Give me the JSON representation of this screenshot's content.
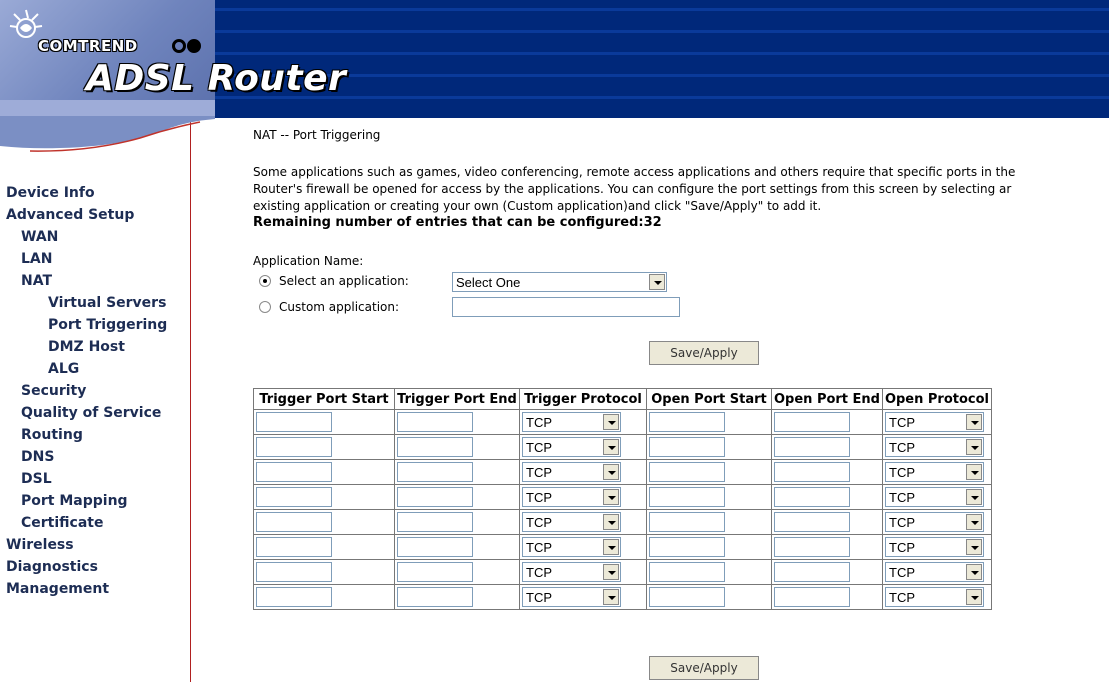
{
  "header": {
    "brand": "COMTREND",
    "product": "ADSL Router"
  },
  "sidebar": {
    "items": [
      {
        "label": "Device Info"
      },
      {
        "label": "Advanced Setup"
      },
      {
        "label": "WAN"
      },
      {
        "label": "LAN"
      },
      {
        "label": "NAT"
      },
      {
        "label": "Virtual Servers"
      },
      {
        "label": "Port Triggering"
      },
      {
        "label": "DMZ Host"
      },
      {
        "label": "ALG"
      },
      {
        "label": "Security"
      },
      {
        "label": "Quality of Service"
      },
      {
        "label": "Routing"
      },
      {
        "label": "DNS"
      },
      {
        "label": "DSL"
      },
      {
        "label": "Port Mapping"
      },
      {
        "label": "Certificate"
      },
      {
        "label": "Wireless"
      },
      {
        "label": "Diagnostics"
      },
      {
        "label": "Management"
      }
    ]
  },
  "main": {
    "title": "NAT -- Port Triggering",
    "description_lines": [
      "Some applications such as games, video conferencing, remote access applications and others require that specific ports in the",
      "Router's firewall be opened for access by the applications. You can configure the port settings from this screen by selecting ar",
      "existing application or creating your own (Custom application)and click \"Save/Apply\" to add it."
    ],
    "remaining": "Remaining number of entries that can be configured:32",
    "app_name_label": "Application Name:",
    "select_app_label": "Select an application:",
    "select_app_value": "Select One",
    "custom_app_label": "Custom application:",
    "save_label": "Save/Apply"
  },
  "table": {
    "headers": [
      "Trigger Port Start",
      "Trigger Port End",
      "Trigger Protocol",
      "Open Port Start",
      "Open Port End",
      "Open Protocol"
    ],
    "rows": [
      {
        "trigger_protocol": "TCP",
        "open_protocol": "TCP"
      },
      {
        "trigger_protocol": "TCP",
        "open_protocol": "TCP"
      },
      {
        "trigger_protocol": "TCP",
        "open_protocol": "TCP"
      },
      {
        "trigger_protocol": "TCP",
        "open_protocol": "TCP"
      },
      {
        "trigger_protocol": "TCP",
        "open_protocol": "TCP"
      },
      {
        "trigger_protocol": "TCP",
        "open_protocol": "TCP"
      },
      {
        "trigger_protocol": "TCP",
        "open_protocol": "TCP"
      },
      {
        "trigger_protocol": "TCP",
        "open_protocol": "TCP"
      }
    ]
  },
  "colors": {
    "banner": "#00287a",
    "nav_text": "#1d2d54",
    "sidebar_border": "#b02020"
  }
}
